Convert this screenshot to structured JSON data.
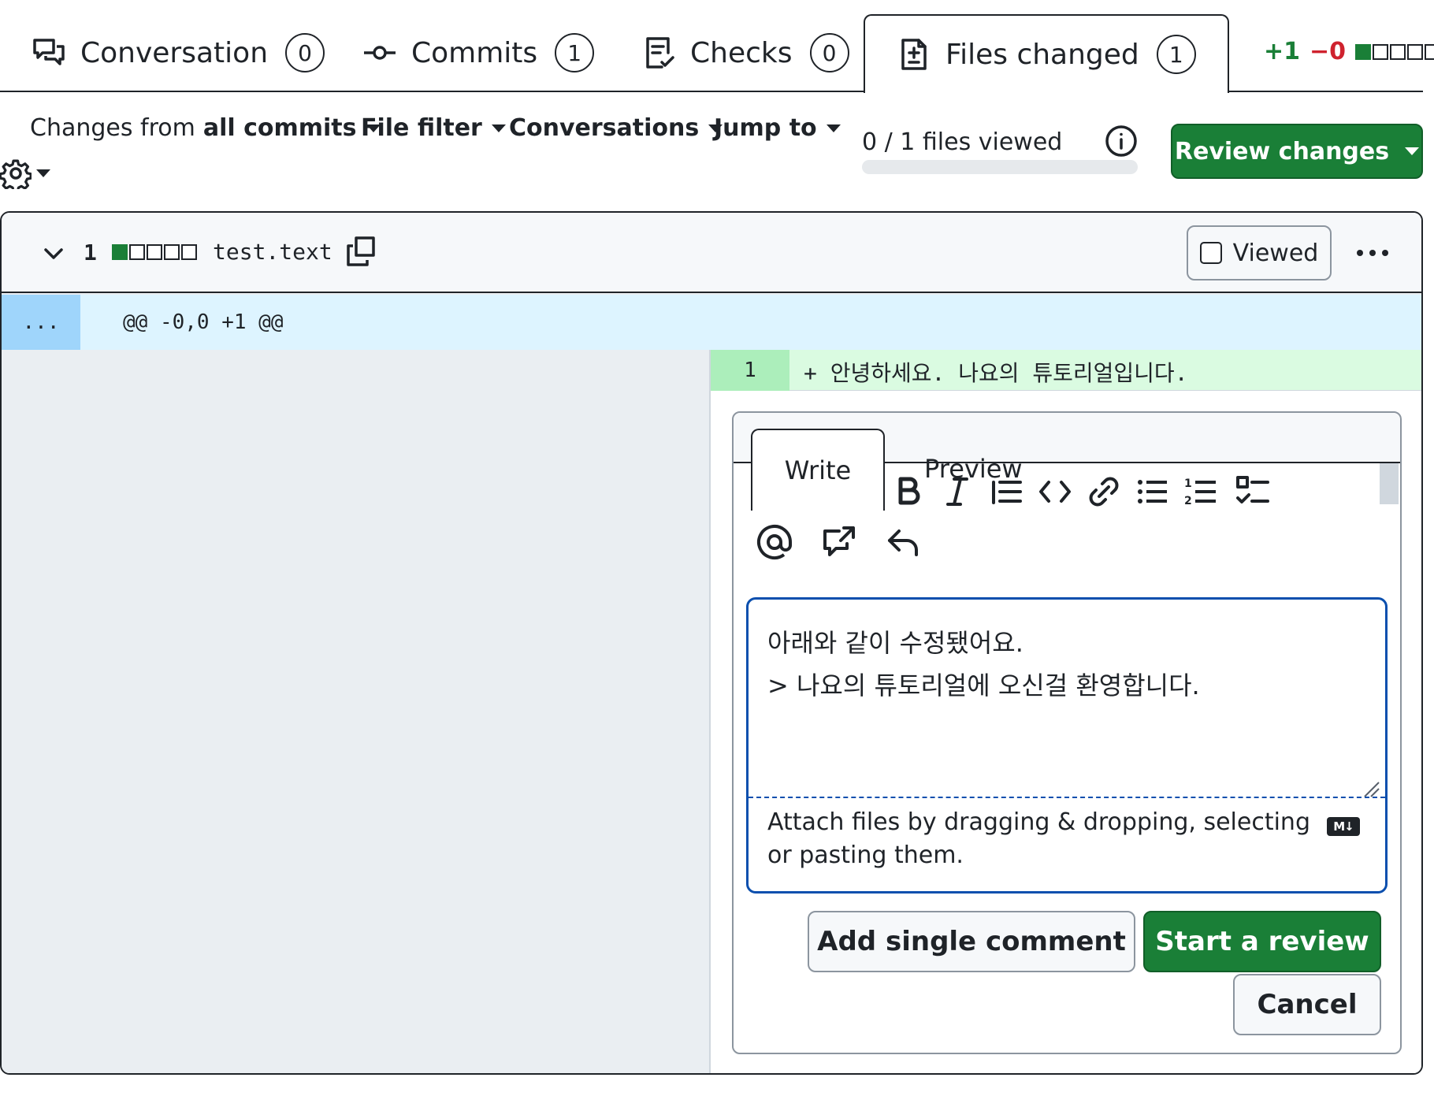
{
  "tabs": [
    {
      "label": "Conversation",
      "count": "0",
      "icon": "comment-discussion-icon"
    },
    {
      "label": "Commits",
      "count": "1",
      "icon": "git-commit-icon"
    },
    {
      "label": "Checks",
      "count": "0",
      "icon": "checklist-icon"
    },
    {
      "label": "Files changed",
      "count": "1",
      "icon": "file-diff-icon",
      "active": true
    }
  ],
  "diffstat": {
    "additions": "+1",
    "deletions": "−0"
  },
  "toolbar": {
    "changes_prefix": "Changes from",
    "changes_value": "all commits",
    "file_filter": "File filter",
    "conversations": "Conversations",
    "jump_to": "Jump to",
    "files_viewed": "0 / 1 files viewed",
    "review_changes": "Review changes"
  },
  "file": {
    "change_count": "1",
    "name": "test.text",
    "viewed_label": "Viewed",
    "hunk_expand": "...",
    "hunk_header": "@@ -0,0 +1 @@",
    "added_line_number": "1",
    "added_line_code": "+ 안녕하세요. 나요의 튜토리얼입니다."
  },
  "comment": {
    "tab_write": "Write",
    "tab_preview": "Preview",
    "text_line1": "아래와 같이 수정됐어요.",
    "text_line2": "> 나요의 튜토리얼에 오신걸 환영합니다.",
    "attach_hint": "Attach files by dragging & dropping, selecting or pasting them.",
    "markdown_badge": "M↓",
    "add_single": "Add single comment",
    "start_review": "Start a review",
    "cancel": "Cancel"
  },
  "colors": {
    "accent_green": "#1a7f37",
    "focus_blue": "#0b4fae",
    "hunk_bg": "#ddf4ff",
    "addition_bg": "#dafbe1"
  }
}
